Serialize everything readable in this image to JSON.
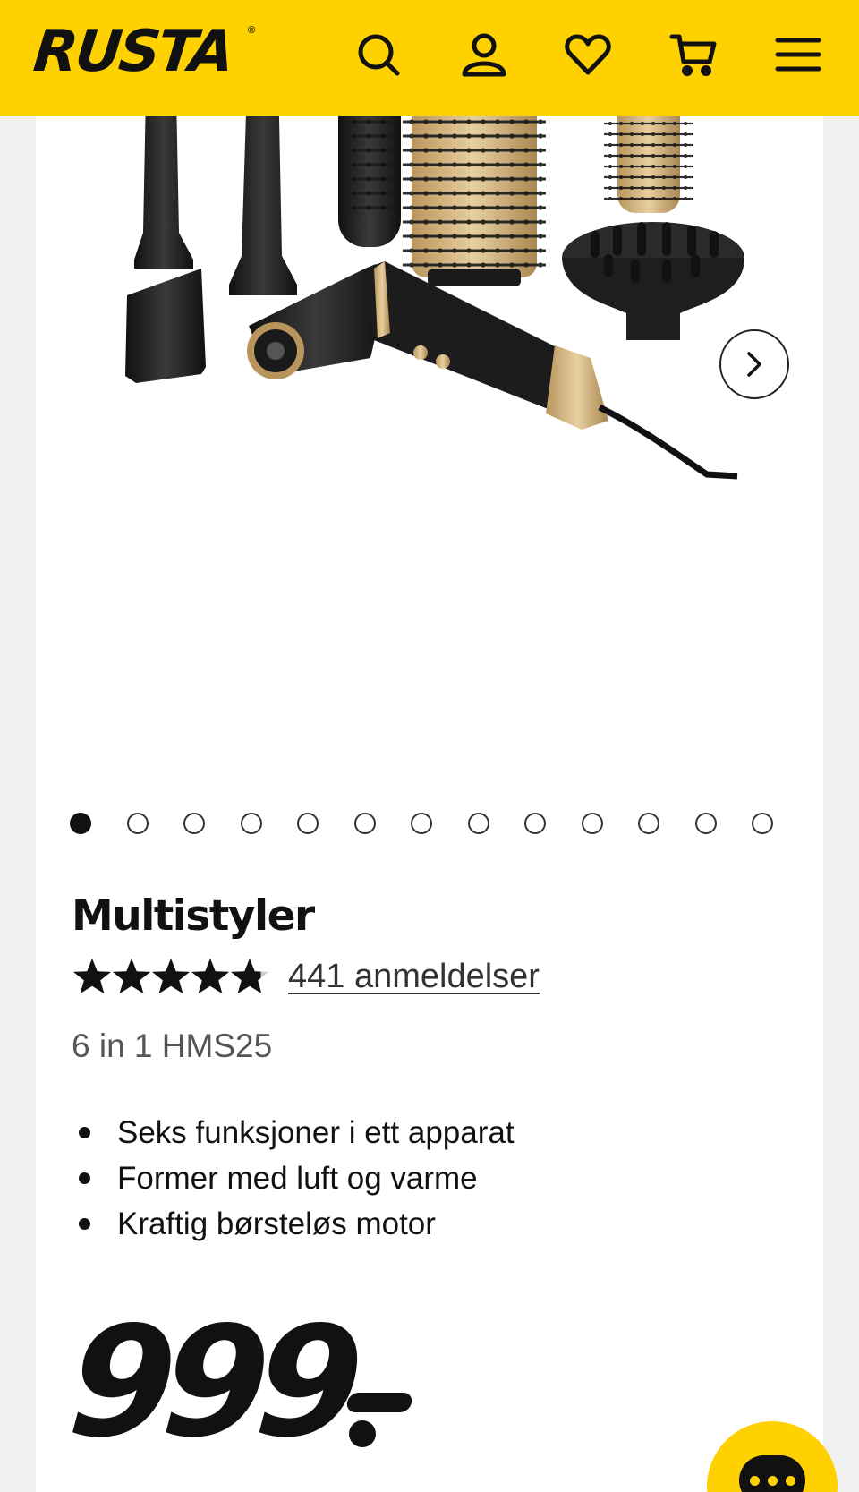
{
  "header": {
    "logo": "RUSTA",
    "logo_mark": "®",
    "background_color": "#ffd100",
    "icons": [
      "search-icon",
      "account-icon",
      "heart-icon",
      "cart-icon",
      "menu-icon"
    ]
  },
  "gallery": {
    "image_count": 13,
    "active_index": 0,
    "next_icon": "chevron-right-icon"
  },
  "product": {
    "title": "Multistyler",
    "rating": 4.8,
    "max_rating": 5,
    "reviews_label": "441 anmeldelser",
    "subtitle": "6 in 1 HMS25",
    "features": [
      "Seks funksjoner i ett apparat",
      "Former med luft og varme",
      "Kraftig børsteløs motor"
    ],
    "price": "999"
  },
  "chat": {
    "icon": "chat-icon",
    "color": "#ffd100"
  }
}
